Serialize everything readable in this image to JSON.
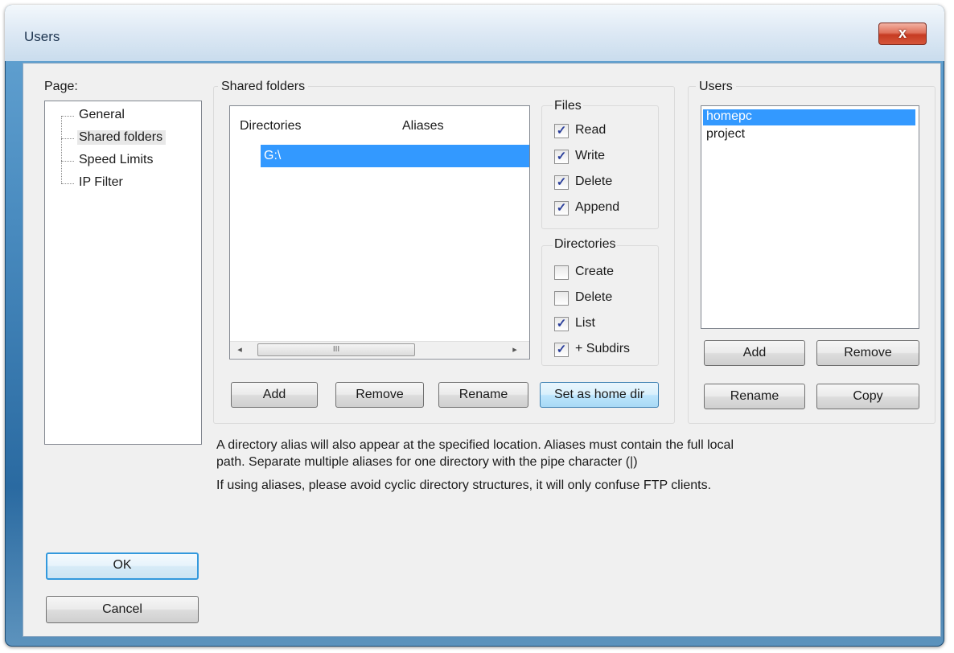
{
  "window": {
    "title": "Users",
    "close_glyph": "x"
  },
  "page_panel": {
    "label": "Page:",
    "items": [
      "General",
      "Shared folders",
      "Speed Limits",
      "IP Filter"
    ]
  },
  "shared_folders": {
    "group_label": "Shared folders",
    "columns": [
      "Directories",
      "Aliases"
    ],
    "rows": [
      {
        "directory": "G:\\",
        "alias": ""
      }
    ],
    "scroll_thumb_glyph": "III",
    "scroll_left_glyph": "◂",
    "scroll_right_glyph": "▸",
    "buttons": {
      "add": "Add",
      "remove": "Remove",
      "rename": "Rename",
      "set_home": "Set as home dir"
    }
  },
  "files": {
    "label": "Files",
    "options": [
      {
        "label": "Read",
        "checked": true
      },
      {
        "label": "Write",
        "checked": true
      },
      {
        "label": "Delete",
        "checked": true
      },
      {
        "label": "Append",
        "checked": true
      }
    ]
  },
  "directories": {
    "label": "Directories",
    "options": [
      {
        "label": "Create",
        "checked": false
      },
      {
        "label": "Delete",
        "checked": false
      },
      {
        "label": "List",
        "checked": true
      },
      {
        "label": "+ Subdirs",
        "checked": true
      }
    ]
  },
  "users": {
    "label": "Users",
    "items": [
      {
        "name": "homepc",
        "selected": true
      },
      {
        "name": "project",
        "selected": false
      }
    ],
    "buttons": {
      "add": "Add",
      "remove": "Remove",
      "rename": "Rename",
      "copy": "Copy"
    }
  },
  "notes": {
    "alias_line1": "A directory alias will also appear at the specified location. Aliases must contain the full local",
    "alias_line2": "path. Separate multiple aliases for one directory with the pipe character (|)",
    "cyclic": "If using aliases, please avoid cyclic directory structures, it will only confuse FTP clients."
  },
  "dialog_buttons": {
    "ok": "OK",
    "cancel": "Cancel"
  },
  "colors": {
    "selection": "#3399ff",
    "title_text": "#1e3550"
  }
}
